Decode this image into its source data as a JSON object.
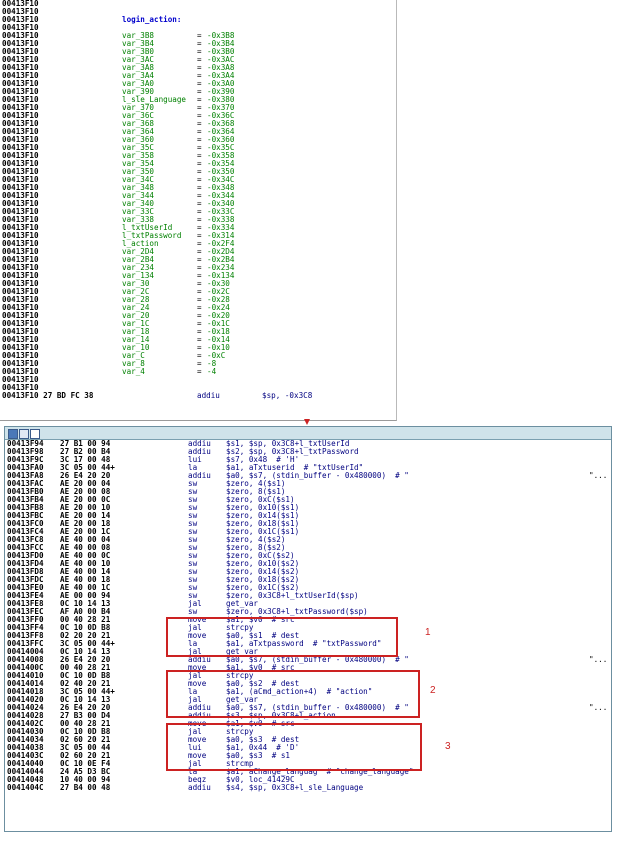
{
  "top_panel": {
    "label": "login_action:",
    "address": "00413F10",
    "vars": [
      {
        "name": "var_3B8",
        "off": "-0x3B8"
      },
      {
        "name": "var_3B4",
        "off": "-0x3B4"
      },
      {
        "name": "var_3B0",
        "off": "-0x3B0"
      },
      {
        "name": "var_3AC",
        "off": "-0x3AC"
      },
      {
        "name": "var_3A8",
        "off": "-0x3A8"
      },
      {
        "name": "var_3A4",
        "off": "-0x3A4"
      },
      {
        "name": "var_3A0",
        "off": "-0x3A0"
      },
      {
        "name": "var_390",
        "off": "-0x390"
      },
      {
        "name": "l_sle_Language",
        "off": "-0x380"
      },
      {
        "name": "var_370",
        "off": "-0x370"
      },
      {
        "name": "var_36C",
        "off": "-0x36C"
      },
      {
        "name": "var_368",
        "off": "-0x368"
      },
      {
        "name": "var_364",
        "off": "-0x364"
      },
      {
        "name": "var_360",
        "off": "-0x360"
      },
      {
        "name": "var_35C",
        "off": "-0x35C"
      },
      {
        "name": "var_358",
        "off": "-0x358"
      },
      {
        "name": "var_354",
        "off": "-0x354"
      },
      {
        "name": "var_350",
        "off": "-0x350"
      },
      {
        "name": "var_34C",
        "off": "-0x34C"
      },
      {
        "name": "var_348",
        "off": "-0x348"
      },
      {
        "name": "var_344",
        "off": "-0x344"
      },
      {
        "name": "var_340",
        "off": "-0x340"
      },
      {
        "name": "var_33C",
        "off": "-0x33C"
      },
      {
        "name": "var_338",
        "off": "-0x338"
      },
      {
        "name": "l_txtUserId",
        "off": "-0x334"
      },
      {
        "name": "l_txtPassword",
        "off": "-0x314"
      },
      {
        "name": "l_action",
        "off": "-0x2F4"
      },
      {
        "name": "var_2D4",
        "off": "-0x2D4"
      },
      {
        "name": "var_2B4",
        "off": "-0x2B4"
      },
      {
        "name": "var_234",
        "off": "-0x234"
      },
      {
        "name": "var_134",
        "off": "-0x134"
      },
      {
        "name": "var_30",
        "off": "-0x30"
      },
      {
        "name": "var_2C",
        "off": "-0x2C"
      },
      {
        "name": "var_28",
        "off": "-0x28"
      },
      {
        "name": "var_24",
        "off": "-0x24"
      },
      {
        "name": "var_20",
        "off": "-0x20"
      },
      {
        "name": "var_1C",
        "off": "-0x1C"
      },
      {
        "name": "var_18",
        "off": "-0x18"
      },
      {
        "name": "var_14",
        "off": "-0x14"
      },
      {
        "name": "var_10",
        "off": "-0x10"
      },
      {
        "name": "var_C",
        "off": "-0xC"
      },
      {
        "name": "var_8",
        "off": "-8"
      },
      {
        "name": "var_4",
        "off": "-4"
      }
    ],
    "last_line": {
      "addr": "00413F10 27 BD FC 38",
      "mn": "addiu",
      "op": "$sp, -0x3C8"
    }
  },
  "bottom_panel": {
    "lines": [
      {
        "addr": "00413F94",
        "bytes": "27 B1 00 94",
        "mn": "addiu",
        "op": "$s1, $sp, 0x3C8+l_txtUserId"
      },
      {
        "addr": "00413F98",
        "bytes": "27 B2 00 B4",
        "mn": "addiu",
        "op": "$s2, $sp, 0x3C8+l_txtPassword"
      },
      {
        "addr": "00413F9C",
        "bytes": "3C 17 00 48",
        "mn": "lui",
        "op": "$s7, 0x48  # 'H'"
      },
      {
        "addr": "00413FA0",
        "bytes": "3C 05 00 44+",
        "mn": "la",
        "op": "$a1, aTxtuserid  # \"txtUserId\""
      },
      {
        "addr": "00413FA8",
        "bytes": "26 E4 20 20",
        "mn": "addiu",
        "op": "$a0, $s7, (stdin_buffer - 0x480000)  # \"",
        "dots": "\"..."
      },
      {
        "addr": "00413FAC",
        "bytes": "AE 20 00 04",
        "mn": "sw",
        "op": "$zero, 4($s1)"
      },
      {
        "addr": "00413FB0",
        "bytes": "AE 20 00 08",
        "mn": "sw",
        "op": "$zero, 8($s1)"
      },
      {
        "addr": "00413FB4",
        "bytes": "AE 20 00 0C",
        "mn": "sw",
        "op": "$zero, 0xC($s1)"
      },
      {
        "addr": "00413FB8",
        "bytes": "AE 20 00 10",
        "mn": "sw",
        "op": "$zero, 0x10($s1)"
      },
      {
        "addr": "00413FBC",
        "bytes": "AE 20 00 14",
        "mn": "sw",
        "op": "$zero, 0x14($s1)"
      },
      {
        "addr": "00413FC0",
        "bytes": "AE 20 00 18",
        "mn": "sw",
        "op": "$zero, 0x18($s1)"
      },
      {
        "addr": "00413FC4",
        "bytes": "AE 20 00 1C",
        "mn": "sw",
        "op": "$zero, 0x1C($s1)"
      },
      {
        "addr": "00413FC8",
        "bytes": "AE 40 00 04",
        "mn": "sw",
        "op": "$zero, 4($s2)"
      },
      {
        "addr": "00413FCC",
        "bytes": "AE 40 00 08",
        "mn": "sw",
        "op": "$zero, 8($s2)"
      },
      {
        "addr": "00413FD0",
        "bytes": "AE 40 00 0C",
        "mn": "sw",
        "op": "$zero, 0xC($s2)"
      },
      {
        "addr": "00413FD4",
        "bytes": "AE 40 00 10",
        "mn": "sw",
        "op": "$zero, 0x10($s2)"
      },
      {
        "addr": "00413FD8",
        "bytes": "AE 40 00 14",
        "mn": "sw",
        "op": "$zero, 0x14($s2)"
      },
      {
        "addr": "00413FDC",
        "bytes": "AE 40 00 18",
        "mn": "sw",
        "op": "$zero, 0x18($s2)"
      },
      {
        "addr": "00413FE0",
        "bytes": "AE 40 00 1C",
        "mn": "sw",
        "op": "$zero, 0x1C($s2)"
      },
      {
        "addr": "00413FE4",
        "bytes": "AE 00 00 94",
        "mn": "sw",
        "op": "$zero, 0x3C8+l_txtUserId($sp)"
      },
      {
        "addr": "00413FE8",
        "bytes": "0C 10 14 13",
        "mn": "jal",
        "op": "get_var"
      },
      {
        "addr": "00413FEC",
        "bytes": "AF A0 00 B4",
        "mn": "sw",
        "op": "$zero, 0x3C8+l_txtPassword($sp)"
      },
      {
        "addr": "00413FF0",
        "bytes": "00 40 28 21",
        "mn": "move",
        "op": "$a1, $v0  # src"
      },
      {
        "addr": "00413FF4",
        "bytes": "0C 10 0D B8",
        "mn": "jal",
        "op": "strcpy"
      },
      {
        "addr": "00413FF8",
        "bytes": "02 20 20 21",
        "mn": "move",
        "op": "$a0, $s1  # dest"
      },
      {
        "addr": "00413FFC",
        "bytes": "3C 05 00 44+",
        "mn": "la",
        "op": "$a1, aTxtpassword  # \"txtPassword\""
      },
      {
        "addr": "00414004",
        "bytes": "0C 10 14 13",
        "mn": "jal",
        "op": "get_var"
      },
      {
        "addr": "00414008",
        "bytes": "26 E4 20 20",
        "mn": "addiu",
        "op": "$a0, $s7, (stdin_buffer - 0x480000)  # \"",
        "dots": "\"..."
      },
      {
        "addr": "0041400C",
        "bytes": "00 40 28 21",
        "mn": "move",
        "op": "$a1, $v0  # src"
      },
      {
        "addr": "00414010",
        "bytes": "0C 10 0D B8",
        "mn": "jal",
        "op": "strcpy"
      },
      {
        "addr": "00414014",
        "bytes": "02 40 20 21",
        "mn": "move",
        "op": "$a0, $s2  # dest"
      },
      {
        "addr": "00414018",
        "bytes": "3C 05 00 44+",
        "mn": "la",
        "op": "$a1, (aCmd_action+4)  # \"action\""
      },
      {
        "addr": "00414020",
        "bytes": "0C 10 14 13",
        "mn": "jal",
        "op": "get_var"
      },
      {
        "addr": "00414024",
        "bytes": "26 E4 20 20",
        "mn": "addiu",
        "op": "$a0, $s7, (stdin_buffer - 0x480000)  # \"",
        "dots": "\"..."
      },
      {
        "addr": "00414028",
        "bytes": "27 B3 00 D4",
        "mn": "addiu",
        "op": "$s3, $sp, 0x3C8+l_action"
      },
      {
        "addr": "0041402C",
        "bytes": "00 40 28 21",
        "mn": "move",
        "op": "$a1, $v0  # src"
      },
      {
        "addr": "00414030",
        "bytes": "0C 10 0D B8",
        "mn": "jal",
        "op": "strcpy"
      },
      {
        "addr": "00414034",
        "bytes": "02 60 20 21",
        "mn": "move",
        "op": "$a0, $s3  # dest"
      },
      {
        "addr": "00414038",
        "bytes": "3C 05 00 44",
        "mn": "lui",
        "op": "$a1, 0x44  # 'D'"
      },
      {
        "addr": "0041403C",
        "bytes": "02 60 20 21",
        "mn": "move",
        "op": "$a0, $s3  # s1"
      },
      {
        "addr": "00414040",
        "bytes": "0C 10 0E F4",
        "mn": "jal",
        "op": "strcmp"
      },
      {
        "addr": "00414044",
        "bytes": "24 A5 D3 BC",
        "mn": "la",
        "op": "$a1, aChange_languag  # \"change_language\""
      },
      {
        "addr": "00414048",
        "bytes": "10 40 00 94",
        "mn": "beqz",
        "op": "$v0, loc_41429C"
      },
      {
        "addr": "0041404C",
        "bytes": "27 B4 00 48",
        "mn": "addiu",
        "op": "$s4, $sp, 0x3C8+l_sle_Language"
      }
    ]
  },
  "callouts": [
    "1",
    "2",
    "3"
  ],
  "colors": {
    "highlight": "#cc2222",
    "titlebar": "#cfe3ea"
  }
}
